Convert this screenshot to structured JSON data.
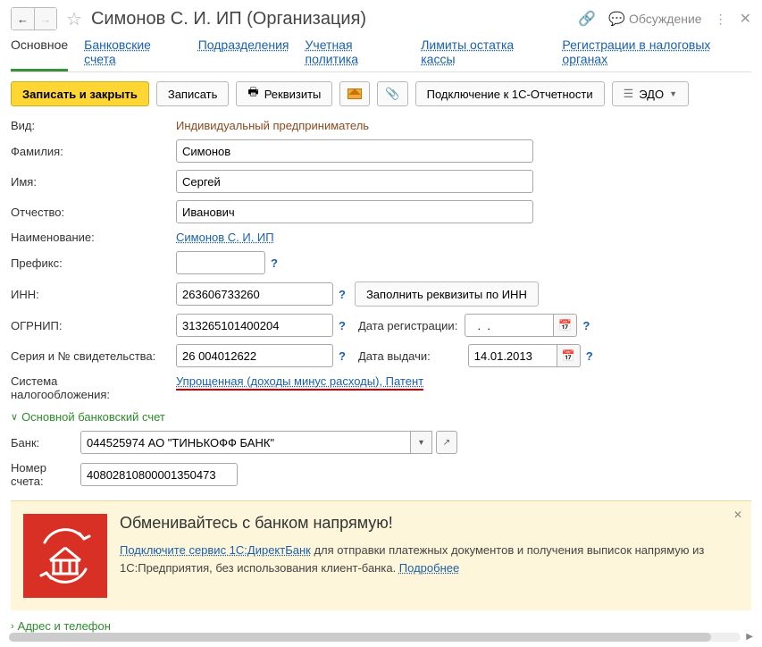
{
  "title": "Симонов С. И. ИП (Организация)",
  "titlebar": {
    "discuss": "Обсуждение"
  },
  "tabs": {
    "main": "Основное",
    "bank_accounts": "Банковские счета",
    "divisions": "Подразделения",
    "account_policy": "Учетная политика",
    "cash_limits": "Лимиты остатка кассы",
    "tax_reg": "Регистрации в налоговых органах"
  },
  "toolbar": {
    "save_close": "Записать и закрыть",
    "save": "Записать",
    "details": "Реквизиты",
    "connect_1c": "Подключение к 1С-Отчетности",
    "edo": "ЭДО"
  },
  "form": {
    "type_label": "Вид:",
    "type_value": "Индивидуальный предприниматель",
    "surname_label": "Фамилия:",
    "surname": "Симонов",
    "name_label": "Имя:",
    "name": "Сергей",
    "patronymic_label": "Отчество:",
    "patronymic": "Иванович",
    "display_label": "Наименование:",
    "display_link": "Симонов С. И. ИП",
    "prefix_label": "Префикс:",
    "prefix": "",
    "inn_label": "ИНН:",
    "inn": "263606733260",
    "fill_by_inn": "Заполнить реквизиты по ИНН",
    "ogrnip_label": "ОГРНИП:",
    "ogrnip": "313265101400204",
    "reg_date_label": "Дата регистрации:",
    "reg_date": "  .  .    ",
    "cert_label": "Серия и № свидетельства:",
    "cert": "26 004012622",
    "issue_date_label": "Дата выдачи:",
    "issue_date": "14.01.2013",
    "tax_label1": "Система",
    "tax_label2": "налогообложения:",
    "tax_link": "Упрощенная (доходы минус расходы), Патент"
  },
  "sections": {
    "bank": "Основной банковский счет",
    "address": "Адрес и телефон"
  },
  "bank": {
    "bank_label": "Банк:",
    "bank_value": "044525974 АО \"ТИНЬКОФФ БАНК\"",
    "account_label": "Номер счета:",
    "account_value": "40802810800001350473"
  },
  "banner": {
    "title": "Обменивайтесь с банком напрямую!",
    "link1": "Подключите сервис 1С:ДиректБанк",
    "text1": " для отправки платежных документов и получения выписок напрямую из 1С:Предприятия, без использования клиент-банка. ",
    "link2": "Подробнее"
  }
}
